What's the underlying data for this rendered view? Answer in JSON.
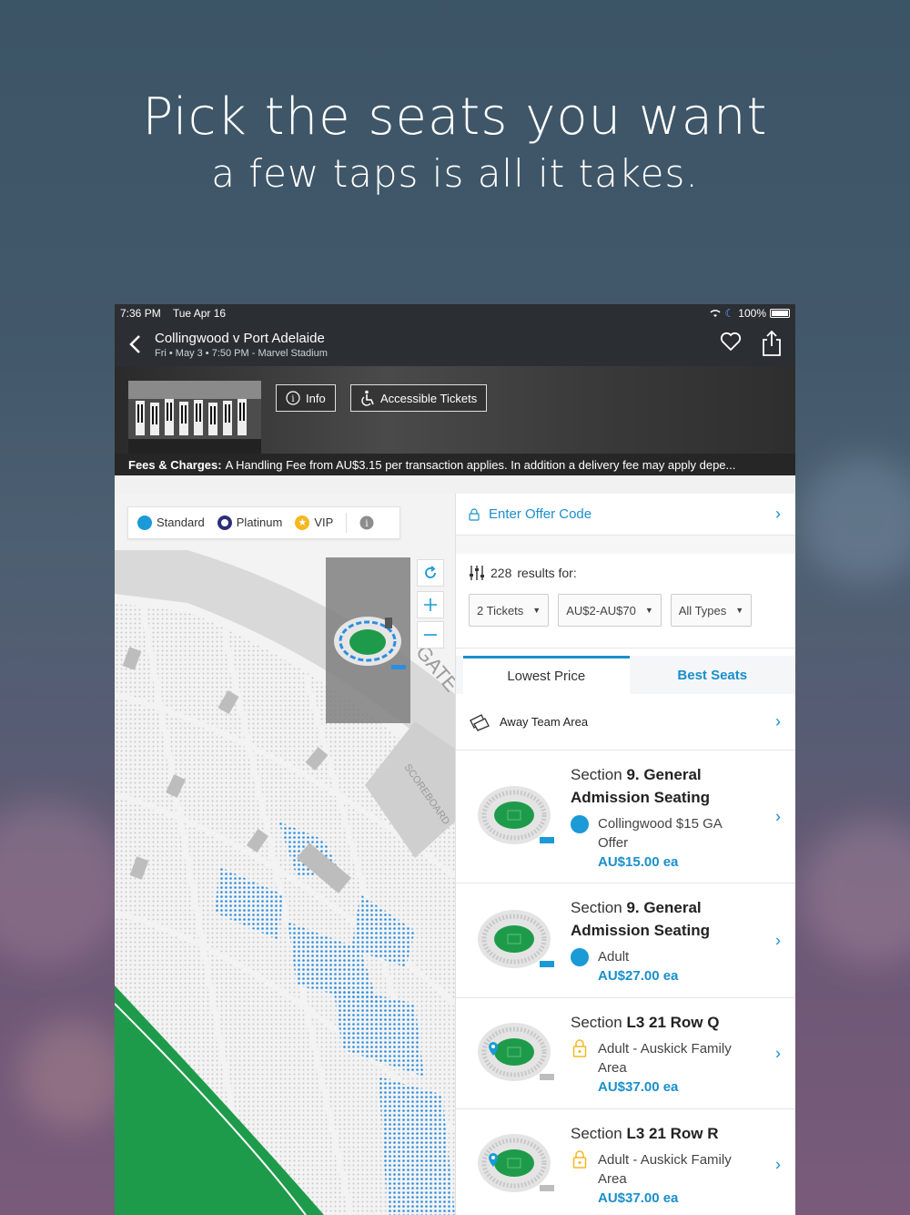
{
  "promo": {
    "headline": "Pick the seats you want",
    "subheadline": "a few taps is all it takes."
  },
  "status": {
    "time": "7:36 PM",
    "date": "Tue Apr 16",
    "battery": "100%"
  },
  "event": {
    "title": "Collingwood v Port Adelaide",
    "subtitle": "Fri • May 3 • 7:50 PM - Marvel Stadium"
  },
  "hero": {
    "info_label": "Info",
    "accessible_label": "Accessible Tickets"
  },
  "fees": {
    "label": "Fees & Charges:",
    "text": "A Handling Fee from AU$3.15 per transaction applies. In addition a delivery fee may apply depe..."
  },
  "legend": {
    "items": [
      {
        "label": "Standard",
        "color": "#1a9ad6"
      },
      {
        "label": "Platinum",
        "color": "#2b2e7a"
      },
      {
        "label": "VIP",
        "color": "#f5b820"
      }
    ]
  },
  "map": {
    "gate_label": "GATE",
    "scoreboard_label": "SCOREBOARD"
  },
  "panel": {
    "offer_label": "Enter Offer Code",
    "results_count": "228",
    "results_text": "results for:",
    "filters": [
      {
        "label": "2 Tickets"
      },
      {
        "label": "AU$2-AU$70"
      },
      {
        "label": "All Types"
      }
    ],
    "tabs": [
      {
        "label": "Lowest Price"
      },
      {
        "label": "Best Seats"
      }
    ],
    "area_label": "Away Team Area"
  },
  "listings": [
    {
      "section_prefix": "Section ",
      "section_bold": "9. General Admission Seating",
      "ptype": "Collingwood $15 GA Offer",
      "price": "AU$15.00 ea",
      "icon": "dot"
    },
    {
      "section_prefix": "Section ",
      "section_bold": "9. General Admission Seating",
      "ptype": "Adult",
      "price": "AU$27.00 ea",
      "icon": "dot"
    },
    {
      "section_prefix": "Section ",
      "section_bold": "L3 21 Row Q",
      "ptype": "Adult - Auskick Family Area",
      "price": "AU$37.00 ea",
      "icon": "lock"
    },
    {
      "section_prefix": "Section ",
      "section_bold": "L3 21 Row R",
      "ptype": "Adult - Auskick Family Area",
      "price": "AU$37.00 ea",
      "icon": "lock"
    }
  ],
  "colors": {
    "accent": "#1a8fcc",
    "dark": "#2b2e33",
    "field": "#1e9b4a"
  }
}
